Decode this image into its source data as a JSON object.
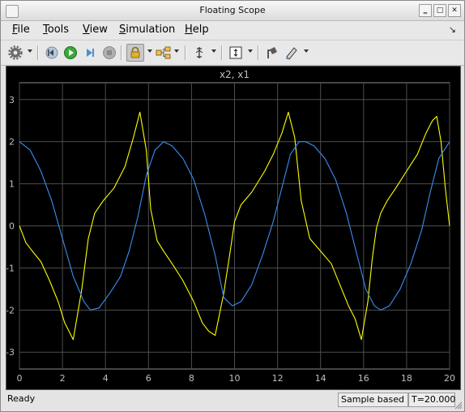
{
  "window": {
    "title": "Floating Scope"
  },
  "menu": {
    "file": {
      "accel": "F",
      "rest": "ile"
    },
    "tools": {
      "accel": "T",
      "rest": "ools"
    },
    "view": {
      "accel": "V",
      "rest": "iew"
    },
    "simulation": {
      "accel": "S",
      "rest": "imulation"
    },
    "help": {
      "accel": "H",
      "rest": "elp"
    },
    "dock_glyph": "↘"
  },
  "toolbar": {
    "buttons": [
      "gear-icon",
      "step-back-icon",
      "run-icon",
      "step-forward-icon",
      "stop-icon",
      "lock-icon",
      "signal-selector-icon",
      "cursor-measure-icon",
      "zoom-y-icon",
      "style-icon",
      "highlight-icon"
    ],
    "lock_pressed": true
  },
  "chart_data": {
    "type": "line",
    "title": "x2, x1",
    "xlim": [
      0,
      20
    ],
    "ylim": [
      -3.4,
      3.4
    ],
    "xticks": [
      "0",
      "2",
      "4",
      "6",
      "8",
      "10",
      "12",
      "14",
      "16",
      "18",
      "20"
    ],
    "yticks": [
      "3",
      "2",
      "1",
      "0",
      "-1",
      "-2",
      "-3"
    ],
    "grid": true,
    "colors": {
      "background": "#000000",
      "grid": "#4d4d4d",
      "axis_text": "#bfbfbf"
    },
    "series": [
      {
        "color": "#ffff00",
        "x": [
          0,
          0.3,
          0.6,
          1.0,
          1.4,
          1.8,
          2.1,
          2.5,
          2.9,
          3.2,
          3.5,
          3.9,
          4.4,
          4.9,
          5.3,
          5.6,
          5.9,
          6.1,
          6.4,
          6.7,
          7.1,
          7.6,
          8.1,
          8.5,
          8.8,
          9.1,
          9.5,
          9.8,
          10.0,
          10.3,
          10.8,
          11.4,
          11.8,
          12.2,
          12.5,
          12.8,
          13.1,
          13.5,
          14.0,
          14.5,
          14.9,
          15.3,
          15.6,
          15.9,
          16.2,
          16.4,
          16.6,
          16.8,
          17.1,
          17.5,
          18.0,
          18.5,
          18.9,
          19.2,
          19.4,
          19.6,
          19.8,
          20.0
        ],
        "y": [
          0.0,
          -0.4,
          -0.6,
          -0.85,
          -1.3,
          -1.8,
          -2.3,
          -2.7,
          -1.5,
          -0.3,
          0.3,
          0.6,
          0.9,
          1.4,
          2.1,
          2.7,
          1.8,
          0.4,
          -0.35,
          -0.6,
          -0.9,
          -1.3,
          -1.8,
          -2.3,
          -2.5,
          -2.6,
          -1.6,
          -0.6,
          0.1,
          0.5,
          0.8,
          1.3,
          1.7,
          2.2,
          2.7,
          2.1,
          0.6,
          -0.3,
          -0.6,
          -0.9,
          -1.4,
          -1.9,
          -2.2,
          -2.7,
          -1.8,
          -0.8,
          -0.05,
          0.3,
          0.6,
          0.9,
          1.3,
          1.7,
          2.2,
          2.5,
          2.6,
          2.0,
          0.9,
          0.0
        ]
      },
      {
        "color": "#3a8ef2",
        "x": [
          0,
          0.5,
          1.0,
          1.5,
          2.0,
          2.5,
          3.0,
          3.3,
          3.7,
          4.2,
          4.7,
          5.1,
          5.5,
          5.9,
          6.3,
          6.7,
          7.1,
          7.6,
          8.1,
          8.6,
          9.1,
          9.5,
          9.9,
          10.3,
          10.8,
          11.3,
          11.8,
          12.2,
          12.6,
          13.0,
          13.3,
          13.7,
          14.2,
          14.7,
          15.2,
          15.7,
          16.1,
          16.5,
          16.8,
          17.2,
          17.7,
          18.2,
          18.7,
          19.1,
          19.5,
          20.0
        ],
        "y": [
          2.0,
          1.8,
          1.3,
          0.6,
          -0.3,
          -1.2,
          -1.8,
          -2.0,
          -1.95,
          -1.6,
          -1.2,
          -0.6,
          0.2,
          1.2,
          1.8,
          2.0,
          1.9,
          1.6,
          1.1,
          0.3,
          -0.7,
          -1.7,
          -1.9,
          -1.8,
          -1.4,
          -0.7,
          0.1,
          0.9,
          1.7,
          2.0,
          2.0,
          1.9,
          1.6,
          1.1,
          0.3,
          -0.7,
          -1.5,
          -1.9,
          -2.0,
          -1.9,
          -1.5,
          -0.9,
          -0.1,
          0.8,
          1.6,
          2.0
        ]
      }
    ]
  },
  "status": {
    "text": "Ready",
    "mode": "Sample based",
    "time": "T=20.000"
  }
}
